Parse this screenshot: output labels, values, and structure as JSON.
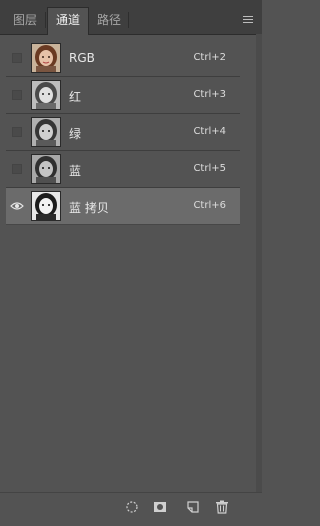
{
  "tabs": [
    {
      "label": "图层",
      "active": false
    },
    {
      "label": "通道",
      "active": true
    },
    {
      "label": "路径",
      "active": false
    }
  ],
  "panel_menu_icon": "hamburger-menu-icon",
  "channels": [
    {
      "name": "RGB",
      "shortcut": "Ctrl+2",
      "visible": false,
      "selected": false,
      "thumbnail": "color"
    },
    {
      "name": "红",
      "shortcut": "Ctrl+3",
      "visible": false,
      "selected": false,
      "thumbnail": "grayscale"
    },
    {
      "name": "绿",
      "shortcut": "Ctrl+4",
      "visible": false,
      "selected": false,
      "thumbnail": "grayscale"
    },
    {
      "name": "蓝",
      "shortcut": "Ctrl+5",
      "visible": false,
      "selected": false,
      "thumbnail": "grayscale"
    },
    {
      "name": "蓝 拷贝",
      "shortcut": "Ctrl+6",
      "visible": true,
      "selected": true,
      "thumbnail": "grayscale-contrast"
    }
  ],
  "bottom_icons": [
    "load-selection-icon",
    "save-selection-icon",
    "new-channel-icon",
    "delete-icon"
  ],
  "colors": {
    "panel_bg": "#535353",
    "tabbar_bg": "#3f3f3f",
    "selected_row_bg": "#6b6b6b",
    "text": "#e6e6e6"
  }
}
